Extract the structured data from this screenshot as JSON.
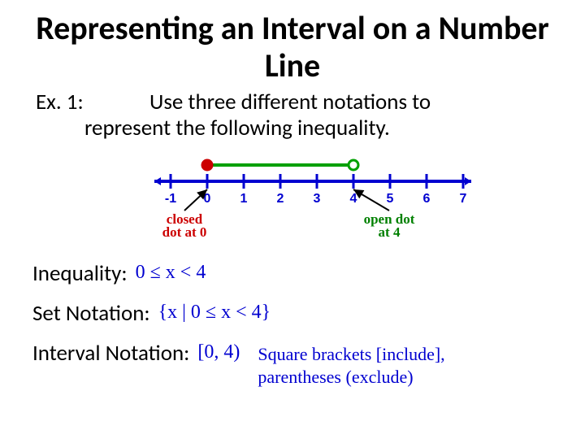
{
  "title": "Representing an Interval on a Number Line",
  "example_label": "Ex. 1:",
  "prompt_line1": "Use three different notations to",
  "prompt_line2": "represent the following inequality.",
  "chart_data": {
    "type": "numberline",
    "min": -1,
    "max": 7,
    "ticks": [
      "-1",
      "0",
      "1",
      "2",
      "3",
      "4",
      "5",
      "6",
      "7"
    ],
    "interval": {
      "start": 0,
      "start_closed": true,
      "end": 4,
      "end_closed": false
    },
    "annotations": [
      {
        "text1": "closed",
        "text2": "dot at 0",
        "at": 0,
        "color": "#cc0000"
      },
      {
        "text1": "open dot",
        "text2": "at 4",
        "at": 4,
        "color": "#008000"
      }
    ]
  },
  "rows": {
    "inequality": {
      "label": "Inequality:",
      "value": "0 ≤ x < 4"
    },
    "set": {
      "label": "Set Notation:",
      "value": "{x | 0 ≤ x < 4}"
    },
    "interval": {
      "label": "Interval Notation:",
      "value": "[0, 4)",
      "note1": "Square brackets [include],",
      "note2": "parentheses (exclude)"
    }
  }
}
